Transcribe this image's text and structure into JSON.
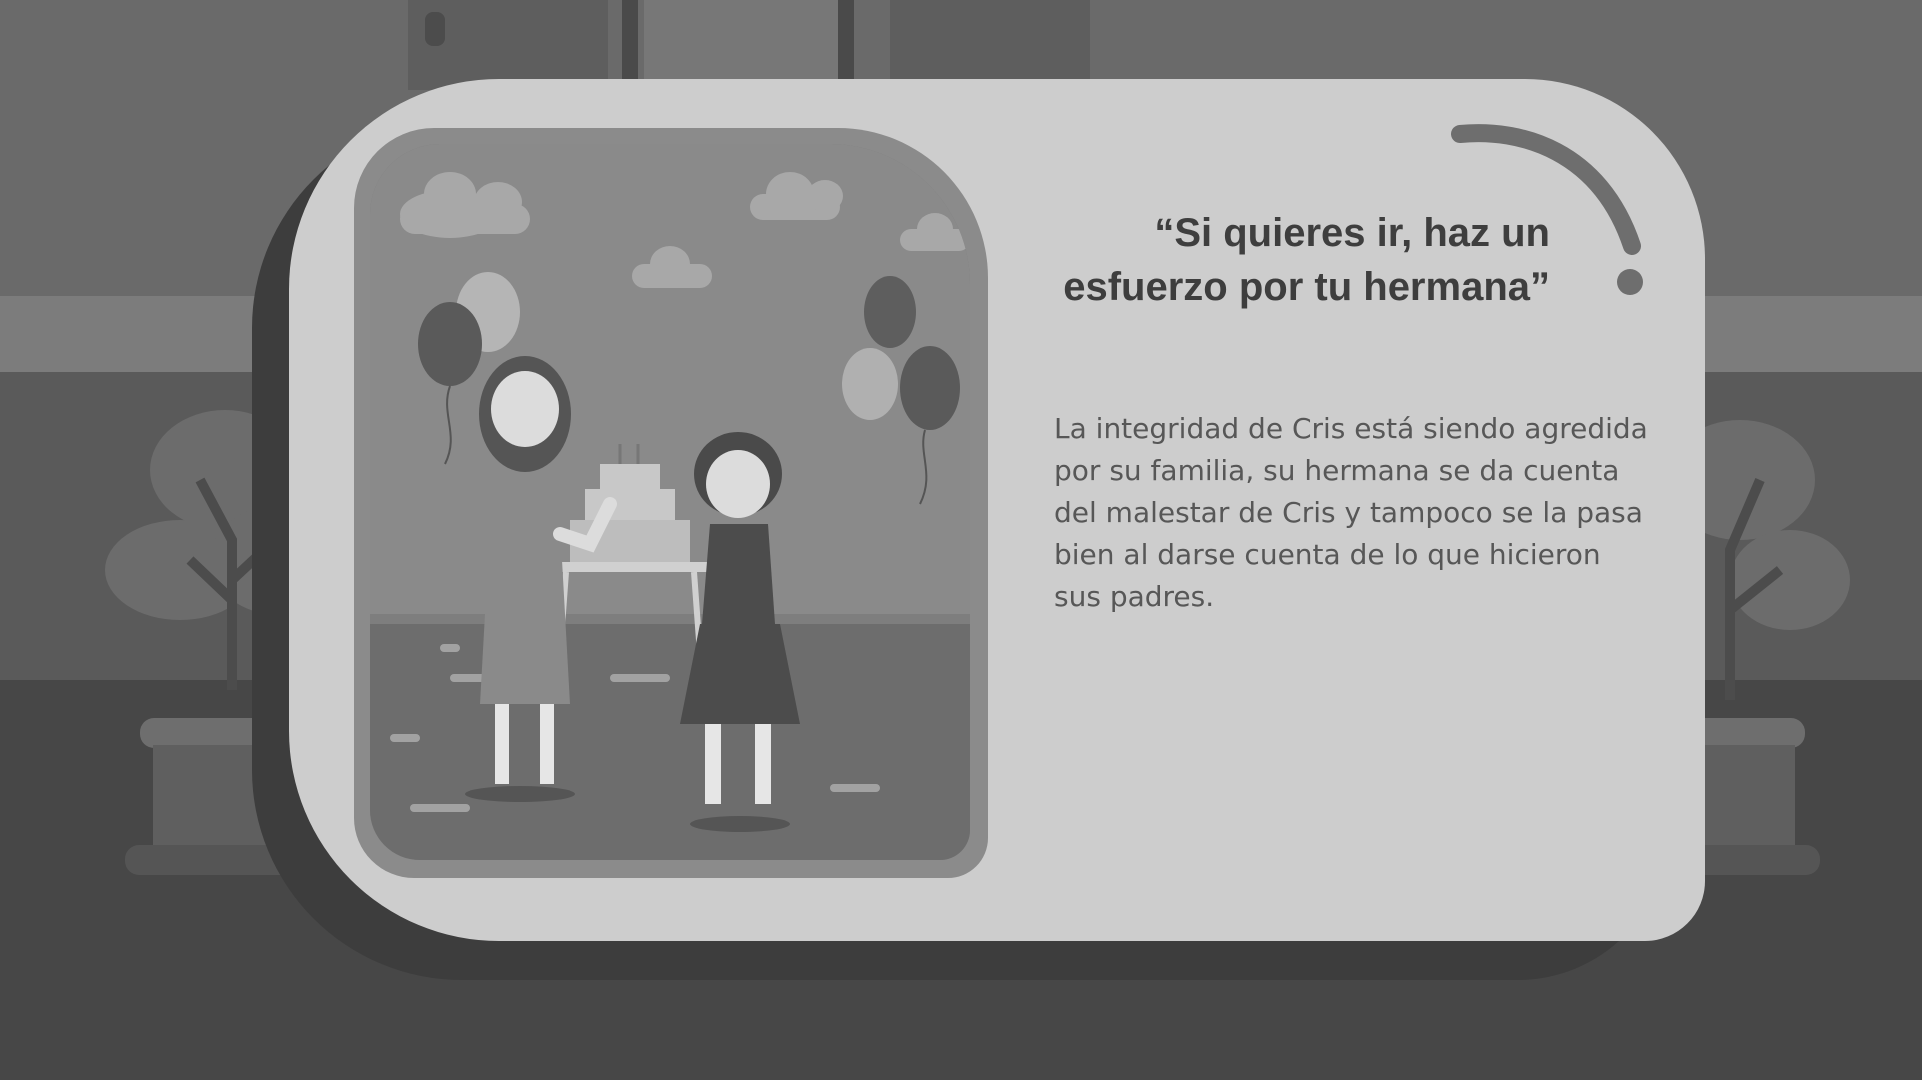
{
  "quote": "“Si quieres ir, haz un esfuerzo por tu hermana”",
  "body": "La integridad de Cris está siendo agredida por su familia, su hermana se da cuenta del malestar de Cris y tampoco se la pasa bien al darse cuenta de lo que hicieron sus padres.",
  "illustration": {
    "description_icons": [
      "balloon-icon",
      "cloud-icon",
      "cake-icon",
      "table-icon",
      "potted-plant-icon",
      "door-icon"
    ]
  },
  "colors": {
    "background_dark": "#474747",
    "card": "#cdcdcd",
    "card_shadow": "#3d3d3d",
    "quote_text": "#3e3e3e",
    "body_text": "#575757"
  }
}
